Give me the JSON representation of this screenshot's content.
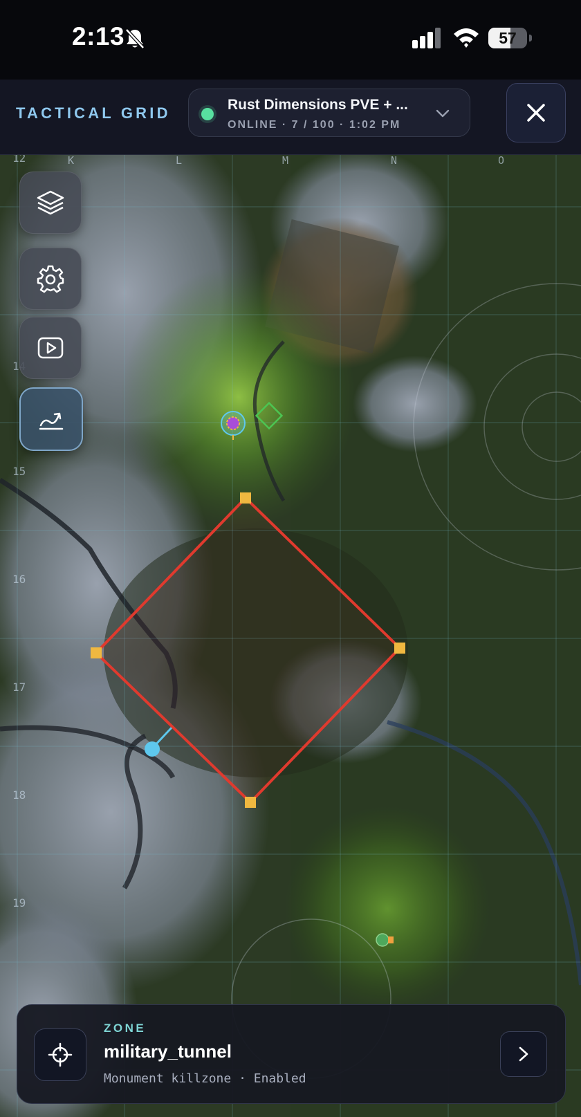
{
  "status_bar": {
    "time": "2:13",
    "battery_level": "57",
    "icons": [
      "bell-slash-icon",
      "cellular-signal-icon",
      "wifi-icon",
      "battery-icon"
    ]
  },
  "header": {
    "brand": "TACTICAL GRID",
    "server": {
      "name": "Rust Dimensions PVE + ...",
      "status": "ONLINE · 7 / 100 · 1:02 PM",
      "status_color": "#58e0a0"
    },
    "icons": [
      "chevron-down-icon",
      "close-icon"
    ]
  },
  "map": {
    "columns": [
      "K",
      "L",
      "M",
      "N",
      "O"
    ],
    "rows": [
      "12",
      "14",
      "15",
      "16",
      "17",
      "18",
      "19"
    ],
    "tools": [
      {
        "name": "layers",
        "icon": "layers-icon"
      },
      {
        "name": "settings",
        "icon": "gear-icon"
      },
      {
        "name": "playback",
        "icon": "play-icon"
      },
      {
        "name": "chart",
        "icon": "chart-line-icon",
        "active": true
      }
    ],
    "zone_color": "#e03a2e",
    "vertex_color": "#f0b840",
    "player_color": "#5ec8ee"
  },
  "zone_card": {
    "tag": "ZONE",
    "name": "military_tunnel",
    "description": "Monument killzone · Enabled",
    "icons": [
      "crosshair-icon",
      "chevron-right-icon"
    ]
  }
}
